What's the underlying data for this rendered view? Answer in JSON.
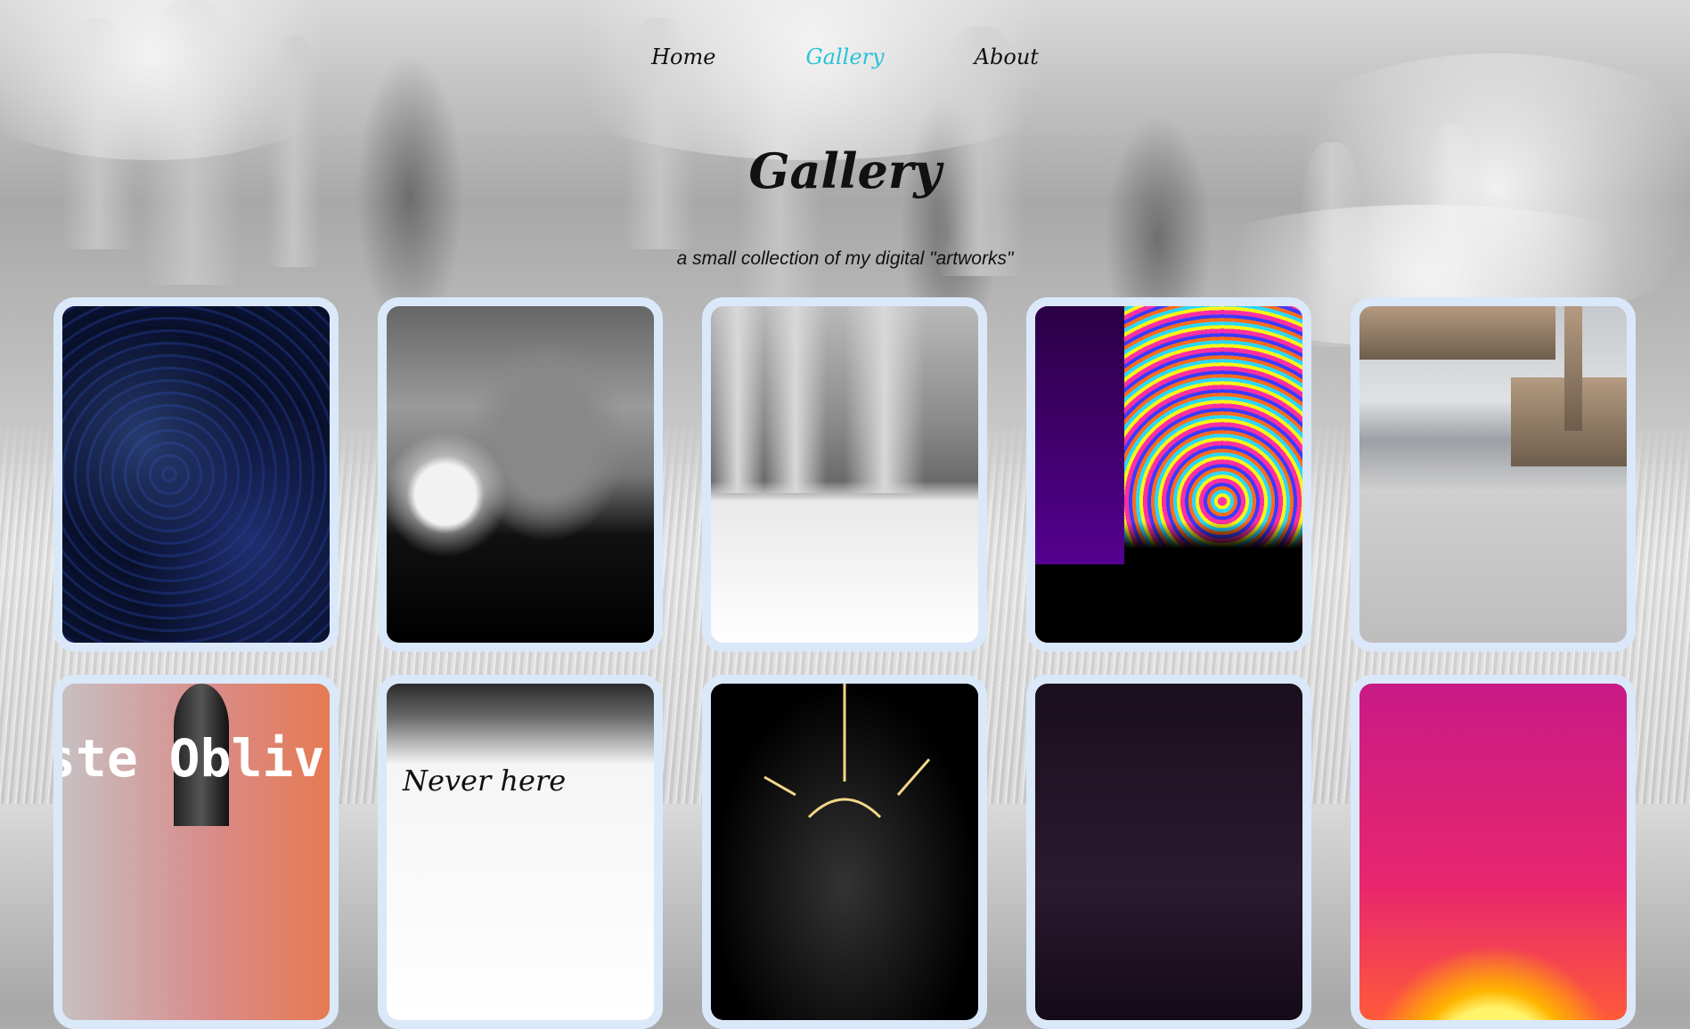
{
  "nav": {
    "items": [
      {
        "label": "Home",
        "active": false
      },
      {
        "label": "Gallery",
        "active": true
      },
      {
        "label": "About",
        "active": false
      }
    ],
    "active_color": "#27c3d6"
  },
  "header": {
    "title": "Gallery",
    "subtitle": "a small collection of my digital \"artworks\""
  },
  "gallery": {
    "frame_color": "#dae8fa",
    "items": [
      {
        "name": "blue-nebula-artwork"
      },
      {
        "name": "moonlit-night-artwork"
      },
      {
        "name": "white-forest-artwork"
      },
      {
        "name": "psychedelic-tree-artwork"
      },
      {
        "name": "floating-structures-artwork"
      },
      {
        "name": "rocket-artwork",
        "text": "ste Obliv"
      },
      {
        "name": "never-here-artwork",
        "text": "Never here"
      },
      {
        "name": "golden-light-artwork"
      },
      {
        "name": "dark-sky-artwork"
      },
      {
        "name": "sunset-artwork"
      }
    ]
  }
}
